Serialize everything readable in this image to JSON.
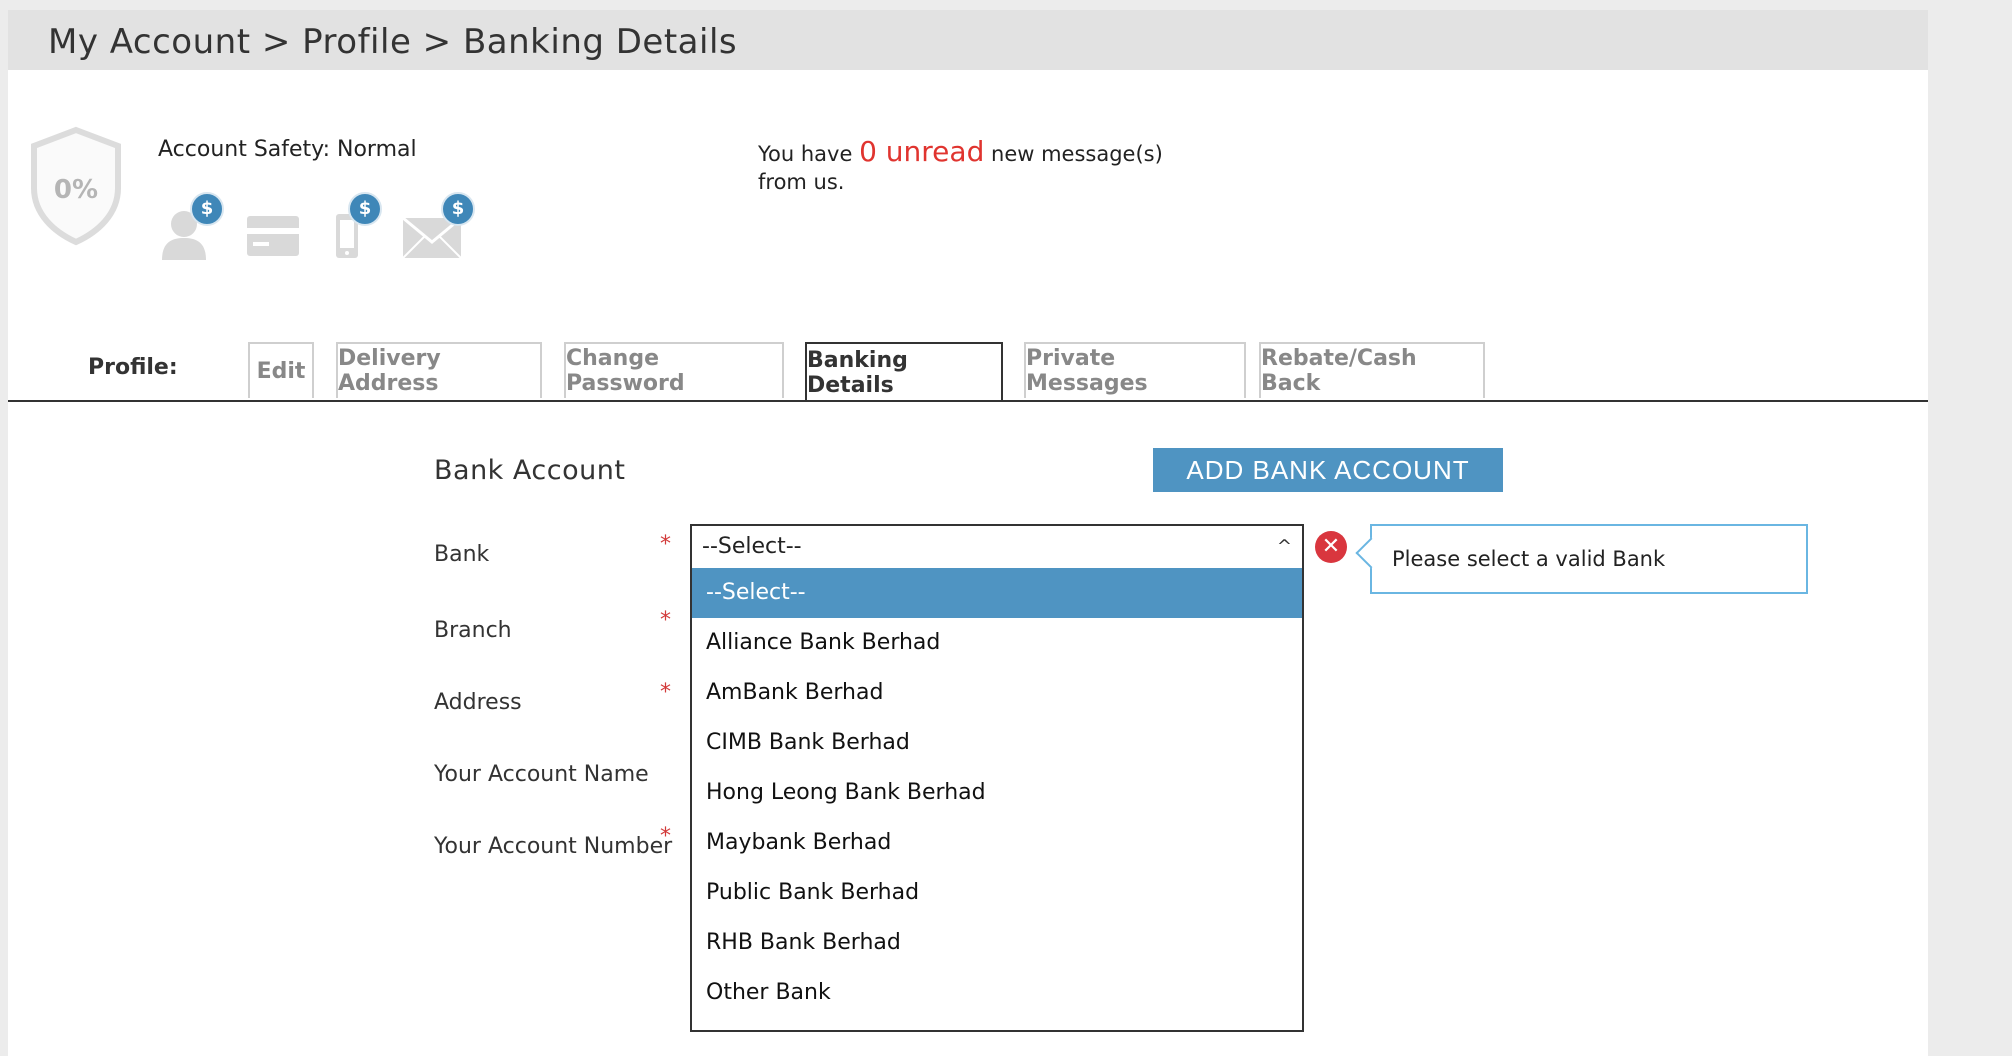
{
  "breadcrumb": "My Account > Profile > Banking Details",
  "safety": {
    "percent": "0%",
    "label": "Account Safety: Normal",
    "badge": "$",
    "icons": [
      "user-icon",
      "credit-card-icon",
      "phone-icon",
      "mail-icon"
    ]
  },
  "messages": {
    "prefix": "You have ",
    "count": "0 unread",
    "suffix": " new message(s) from us."
  },
  "profile_label": "Profile:",
  "tabs": [
    {
      "label": "Edit"
    },
    {
      "label": "Delivery Address"
    },
    {
      "label": "Change Password"
    },
    {
      "label": "Banking Details",
      "active": true
    },
    {
      "label": "Private Messages"
    },
    {
      "label": "Rebate/Cash Back"
    }
  ],
  "form": {
    "section_title": "Bank Account",
    "add_button": "ADD BANK ACCOUNT",
    "fields": {
      "bank": "Bank",
      "branch": "Branch",
      "address": "Address",
      "account_name": "Your Account Name",
      "account_number": "Your Account Number"
    },
    "required_mark": "*",
    "bank_select_value": "--Select--",
    "bank_options": [
      "--Select--",
      "Alliance Bank Berhad",
      "AmBank Berhad",
      "CIMB Bank Berhad",
      "Hong Leong Bank Berhad",
      "Maybank Berhad",
      "Public Bank Berhad",
      "RHB Bank Berhad",
      "Other Bank"
    ],
    "error_message": "Please select a valid Bank"
  },
  "colors": {
    "accent": "#4f94c2",
    "error": "#d9363e",
    "unread": "#e0342f",
    "tooltip_border": "#6ab6e2"
  }
}
